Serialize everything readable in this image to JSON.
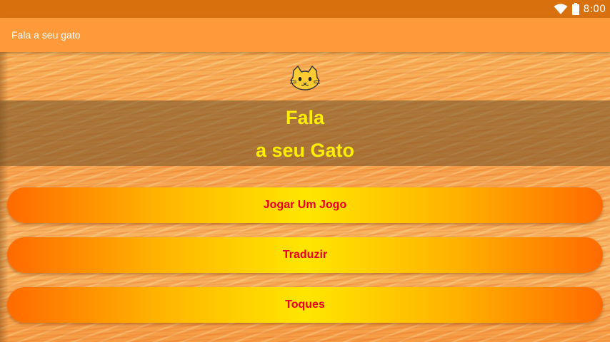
{
  "status_bar": {
    "time": "8:00",
    "icons": [
      "wifi-icon",
      "battery-icon"
    ],
    "color": "#d9700e"
  },
  "app_bar": {
    "title": "Fala a seu gato",
    "color": "#ff9a3a"
  },
  "main": {
    "header_icon": "cat-face-icon",
    "title_line1": "Fala",
    "title_line2": "a seu Gato",
    "title_color": "#ffee00",
    "buttons": [
      {
        "label": "Jogar Um Jogo"
      },
      {
        "label": "Traduzir"
      },
      {
        "label": "Toques"
      }
    ],
    "button_text_color": "#e8001e"
  }
}
